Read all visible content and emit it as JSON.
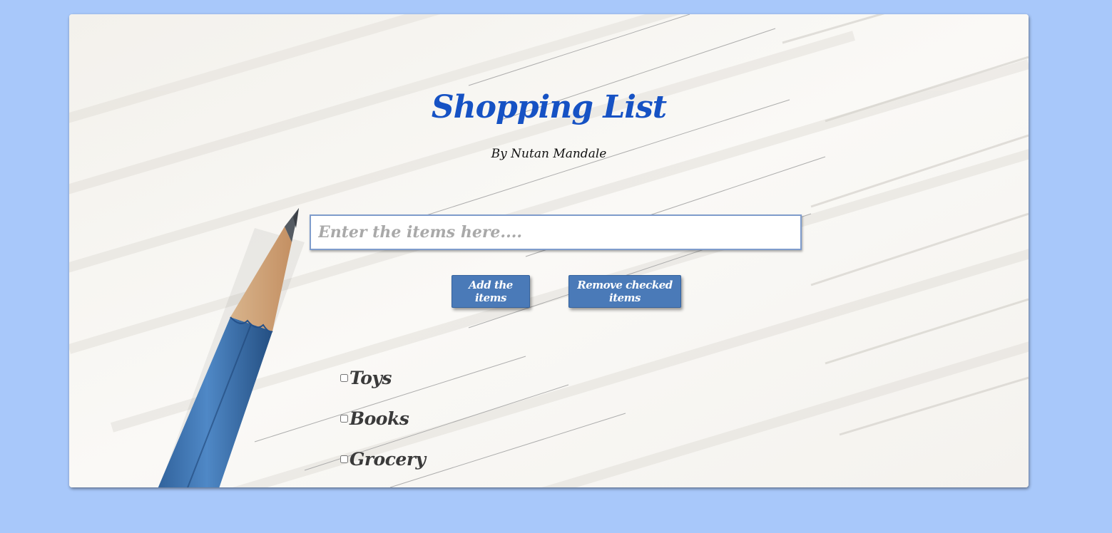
{
  "header": {
    "title": "Shopping List",
    "subtitle": "By Nutan Mandale"
  },
  "form": {
    "input_placeholder": "Enter the items here....",
    "input_value": "",
    "add_button_label": "Add the items",
    "remove_button_label": "Remove checked items"
  },
  "items": [
    {
      "label": "Toys",
      "checked": false
    },
    {
      "label": "Books",
      "checked": false
    },
    {
      "label": "Grocery",
      "checked": false
    }
  ],
  "colors": {
    "page_background": "#a8c8fa",
    "title": "#1652c4",
    "button": "#4a7ab8",
    "pencil": "#3a6ea8"
  },
  "icons": {
    "background": "pencil-on-lined-paper-image"
  }
}
